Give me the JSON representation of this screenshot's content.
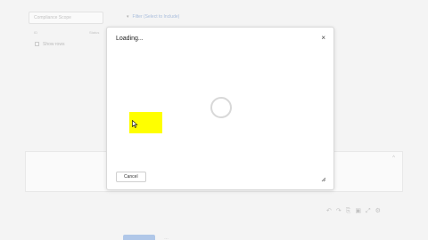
{
  "background": {
    "field_text": "Compliance Scope",
    "link_text": "Filter (Select to Include)",
    "columns": [
      "ID",
      "Status"
    ],
    "row_text": "Show rows",
    "panel_chevron": "^"
  },
  "dialog": {
    "title": "Loading...",
    "close_glyph": "×",
    "cancel_label": "Cancel"
  },
  "colors": {
    "highlight": "#ffff00",
    "primary_button": "#7aa3e0"
  }
}
